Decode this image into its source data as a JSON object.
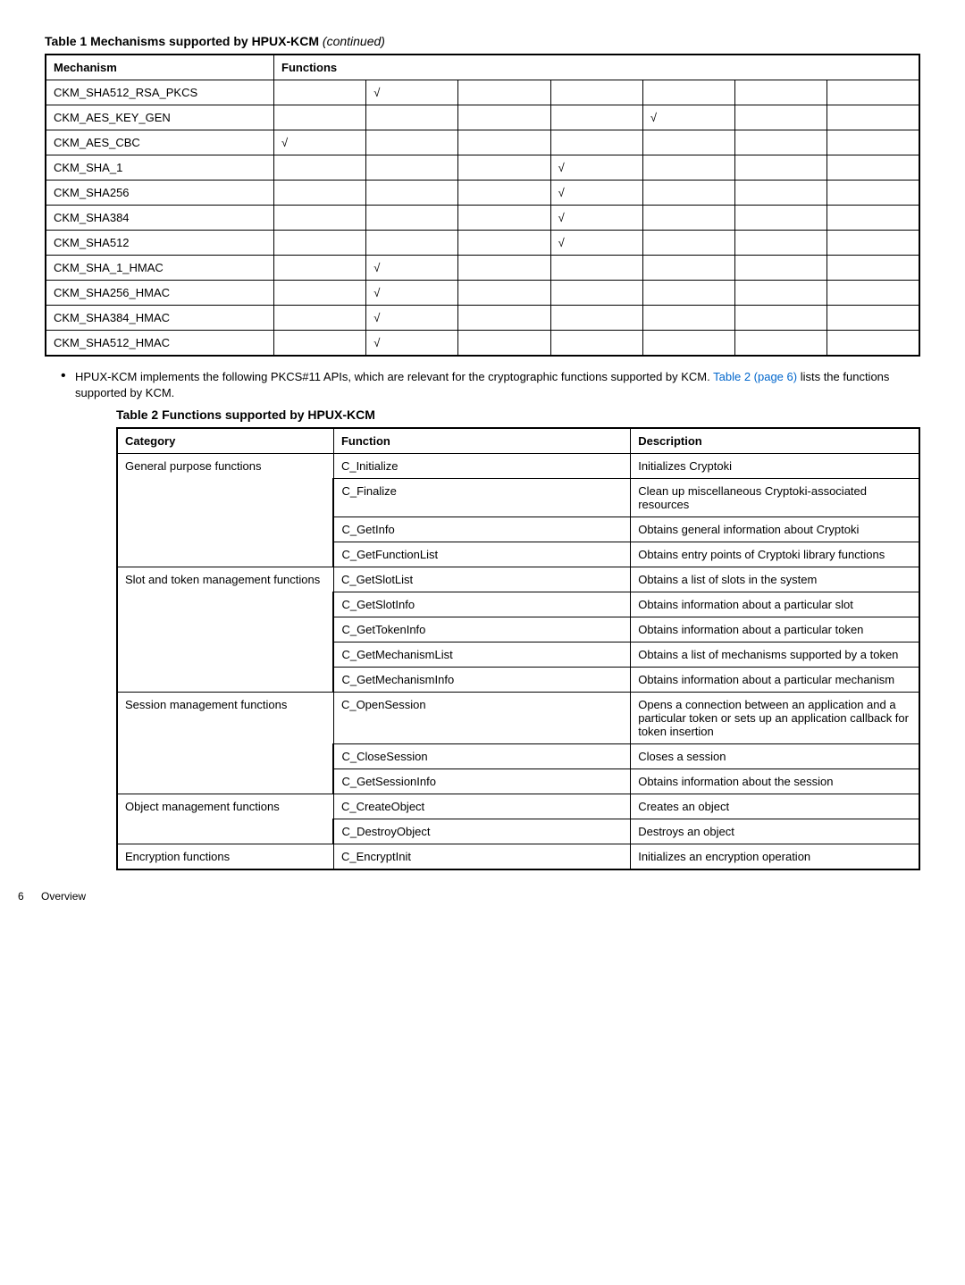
{
  "table1": {
    "caption_prefix": "Table 1 Mechanisms supported by HPUX-KCM",
    "caption_suffix": "(continued)",
    "header": {
      "mechanism": "Mechanism",
      "functions": "Functions"
    },
    "check": "√",
    "rows": [
      {
        "name": "CKM_SHA512_RSA_PKCS",
        "cols": [
          "",
          "√",
          "",
          "",
          "",
          "",
          ""
        ]
      },
      {
        "name": "CKM_AES_KEY_GEN",
        "cols": [
          "",
          "",
          "",
          "",
          "√",
          "",
          ""
        ]
      },
      {
        "name": "CKM_AES_CBC",
        "cols": [
          "√",
          "",
          "",
          "",
          "",
          "",
          ""
        ]
      },
      {
        "name": "CKM_SHA_1",
        "cols": [
          "",
          "",
          "",
          "√",
          "",
          "",
          ""
        ]
      },
      {
        "name": "CKM_SHA256",
        "cols": [
          "",
          "",
          "",
          "√",
          "",
          "",
          ""
        ]
      },
      {
        "name": "CKM_SHA384",
        "cols": [
          "",
          "",
          "",
          "√",
          "",
          "",
          ""
        ]
      },
      {
        "name": "CKM_SHA512",
        "cols": [
          "",
          "",
          "",
          "√",
          "",
          "",
          ""
        ]
      },
      {
        "name": "CKM_SHA_1_HMAC",
        "cols": [
          "",
          "√",
          "",
          "",
          "",
          "",
          ""
        ]
      },
      {
        "name": "CKM_SHA256_HMAC",
        "cols": [
          "",
          "√",
          "",
          "",
          "",
          "",
          ""
        ]
      },
      {
        "name": "CKM_SHA384_HMAC",
        "cols": [
          "",
          "√",
          "",
          "",
          "",
          "",
          ""
        ]
      },
      {
        "name": "CKM_SHA512_HMAC",
        "cols": [
          "",
          "√",
          "",
          "",
          "",
          "",
          ""
        ]
      }
    ]
  },
  "bullet": {
    "part1": "HPUX-KCM implements the following PKCS#11 APIs, which are relevant for the cryptographic functions supported by KCM. ",
    "link": "Table 2 (page 6)",
    "part2": " lists the functions supported by KCM."
  },
  "table2": {
    "caption": "Table 2 Functions supported by HPUX-KCM",
    "header": {
      "category": "Category",
      "function": "Function",
      "description": "Description"
    },
    "groups": [
      {
        "category": "General purpose functions",
        "items": [
          {
            "fn": "C_Initialize",
            "desc": "Initializes Cryptoki"
          },
          {
            "fn": "C_Finalize",
            "desc": "Clean up miscellaneous Cryptoki-associated resources"
          },
          {
            "fn": "C_GetInfo",
            "desc": "Obtains general information about Cryptoki"
          },
          {
            "fn": "C_GetFunctionList",
            "desc": "Obtains entry points of Cryptoki library functions"
          }
        ]
      },
      {
        "category": "Slot and token management functions",
        "items": [
          {
            "fn": "C_GetSlotList",
            "desc": "Obtains a list of slots in the system"
          },
          {
            "fn": "C_GetSlotInfo",
            "desc": "Obtains information about a particular slot"
          },
          {
            "fn": "C_GetTokenInfo",
            "desc": "Obtains information about a particular token"
          },
          {
            "fn": "C_GetMechanismList",
            "desc": "Obtains a list of mechanisms supported by a token"
          },
          {
            "fn": "C_GetMechanismInfo",
            "desc": "Obtains information about a particular mechanism"
          }
        ]
      },
      {
        "category": "Session management functions",
        "items": [
          {
            "fn": "C_OpenSession",
            "desc": "Opens a connection between an application and a particular token or sets up an application callback for token insertion"
          },
          {
            "fn": "C_CloseSession",
            "desc": "Closes a session"
          },
          {
            "fn": "C_GetSessionInfo",
            "desc": "Obtains information about the session"
          }
        ]
      },
      {
        "category": "Object management functions",
        "items": [
          {
            "fn": "C_CreateObject",
            "desc": "Creates an object"
          },
          {
            "fn": "C_DestroyObject",
            "desc": "Destroys an object"
          }
        ]
      },
      {
        "category": "Encryption functions",
        "items": [
          {
            "fn": "C_EncryptInit",
            "desc": "Initializes an encryption operation"
          }
        ]
      }
    ]
  },
  "footer": {
    "page": "6",
    "section": "Overview"
  }
}
